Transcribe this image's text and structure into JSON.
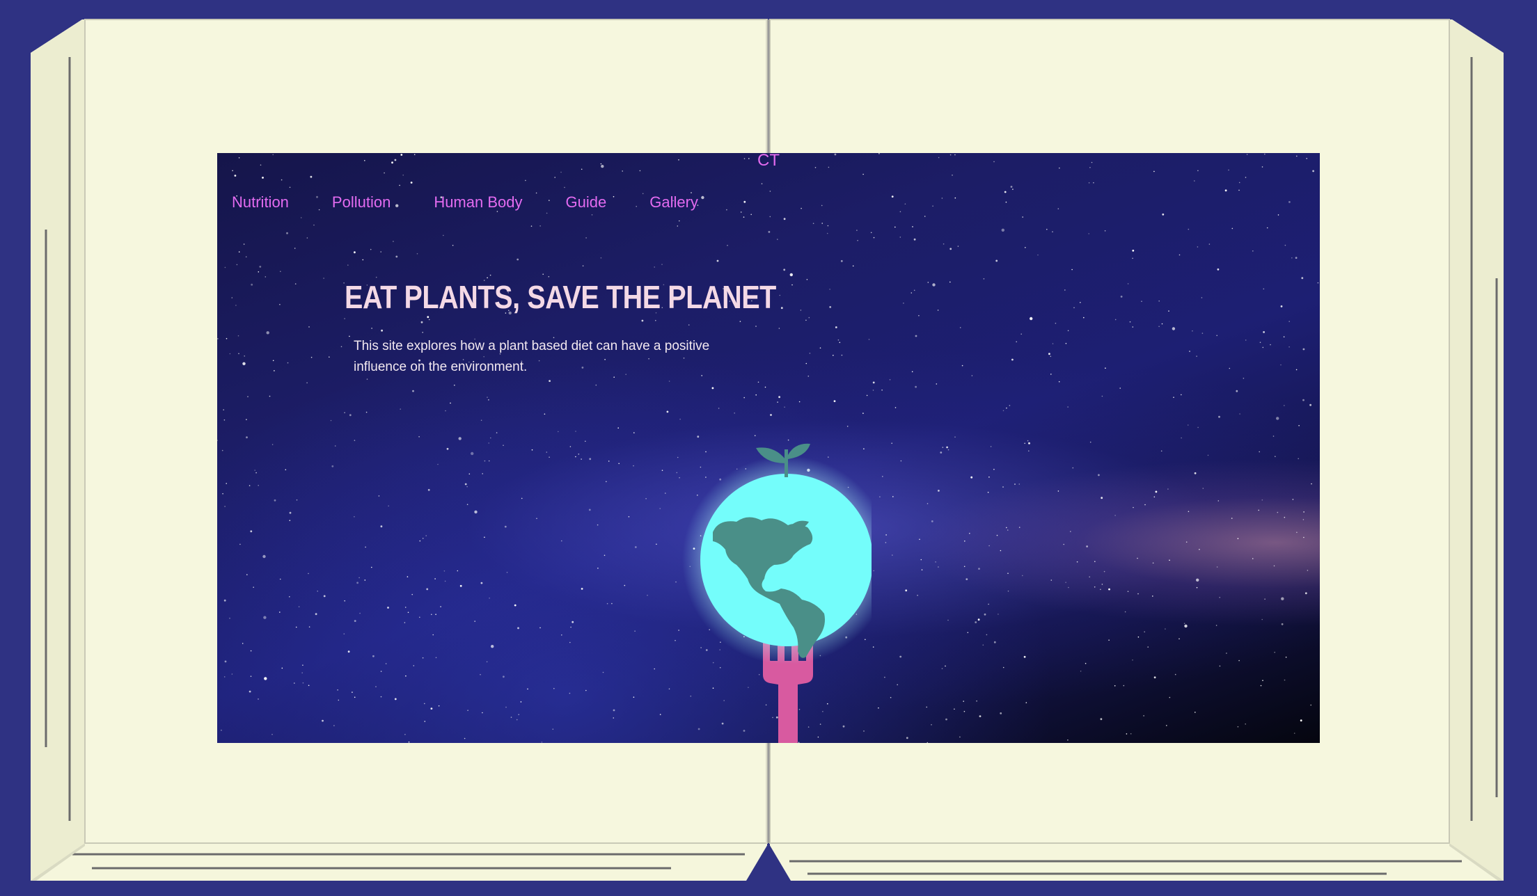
{
  "brand": {
    "text": "CT"
  },
  "nav": {
    "items": [
      {
        "label": "Nutrition"
      },
      {
        "label": "Pollution"
      },
      {
        "label": "Human Body"
      },
      {
        "label": "Guide"
      },
      {
        "label": "Gallery"
      }
    ]
  },
  "hero": {
    "title": "EAT PLANTS, SAVE THE PLANET",
    "subtitle": "This site explores how a plant based diet can have a positive influence on the environment."
  },
  "logo": {
    "icon": "earth-on-fork-icon"
  },
  "colors": {
    "frame": "#2f3283",
    "page": "#f5f6dc",
    "nav_link": "#e36bf0",
    "title": "#f4d9e6",
    "globe": "#74fdfb",
    "continents": "#4a8f88",
    "fork": "#d85aa0"
  }
}
